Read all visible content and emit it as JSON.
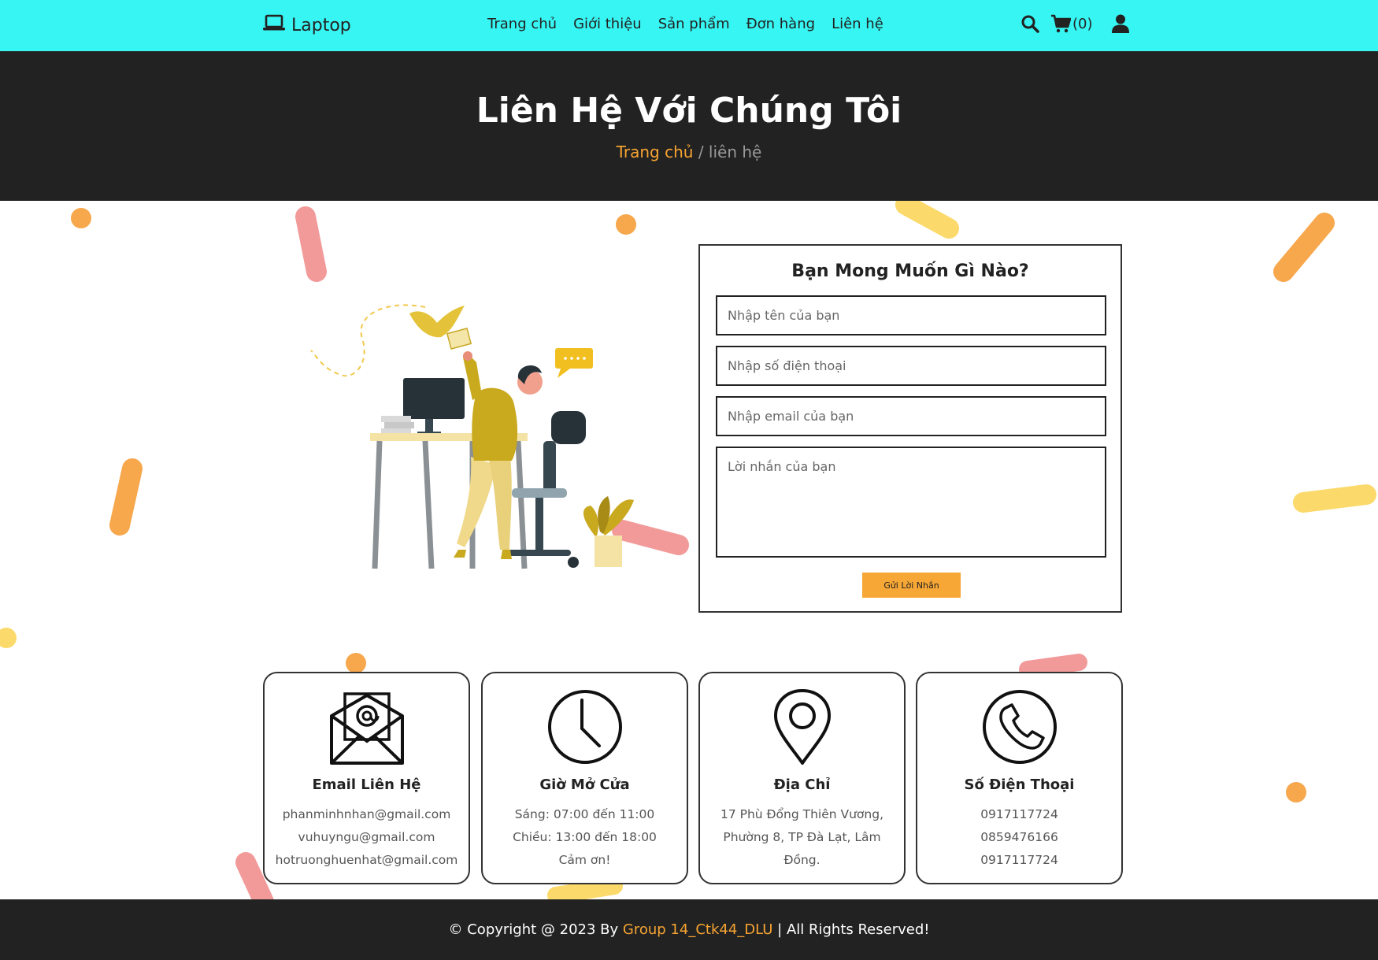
{
  "header": {
    "logo": "Laptop",
    "nav": [
      "Trang chủ",
      "Giới thiệu",
      "Sản phẩm",
      "Đơn hàng",
      "Liên hệ"
    ],
    "cart_count": "(0)"
  },
  "hero": {
    "title": "Liên Hệ Với Chúng Tôi",
    "breadcrumb_home": "Trang chủ",
    "breadcrumb_sep": " / ",
    "breadcrumb_current": "liên hệ"
  },
  "form": {
    "title": "Bạn Mong Muốn Gì Nào?",
    "name_placeholder": "Nhập tên của bạn",
    "phone_placeholder": "Nhập số điện thoại",
    "email_placeholder": "Nhập email của bạn",
    "message_placeholder": "Lời nhắn của bạn",
    "submit_label": "Gửi Lời Nhắn"
  },
  "cards": [
    {
      "title": "Email Liên Hệ",
      "lines": [
        "phanminhnhan@gmail.com",
        "vuhuyngu@gmail.com",
        "hotruonghuenhat@gmail.com"
      ],
      "icon": "email-icon"
    },
    {
      "title": "Giờ Mở Cửa",
      "lines": [
        "Sáng: 07:00 đến 11:00",
        "Chiều: 13:00 đến 18:00",
        "Cảm ơn!"
      ],
      "icon": "clock-icon"
    },
    {
      "title": "Địa Chỉ",
      "lines": [
        "17 Phù Đổng Thiên Vương,",
        "Phường 8, TP Đà Lạt, Lâm",
        "Đồng."
      ],
      "icon": "location-pin-icon"
    },
    {
      "title": "Số Điện Thoại",
      "lines": [
        "0917117724",
        "0859476166",
        "0917117724"
      ],
      "icon": "phone-icon"
    }
  ],
  "footer": {
    "prefix": "© Copyright @ 2023 By ",
    "group": "Group 14_Ctk44_DLU",
    "suffix": " | All Rights Reserved!"
  },
  "colors": {
    "header_bg": "#37f5f2",
    "dark_bg": "#222222",
    "accent": "#f7a432"
  }
}
